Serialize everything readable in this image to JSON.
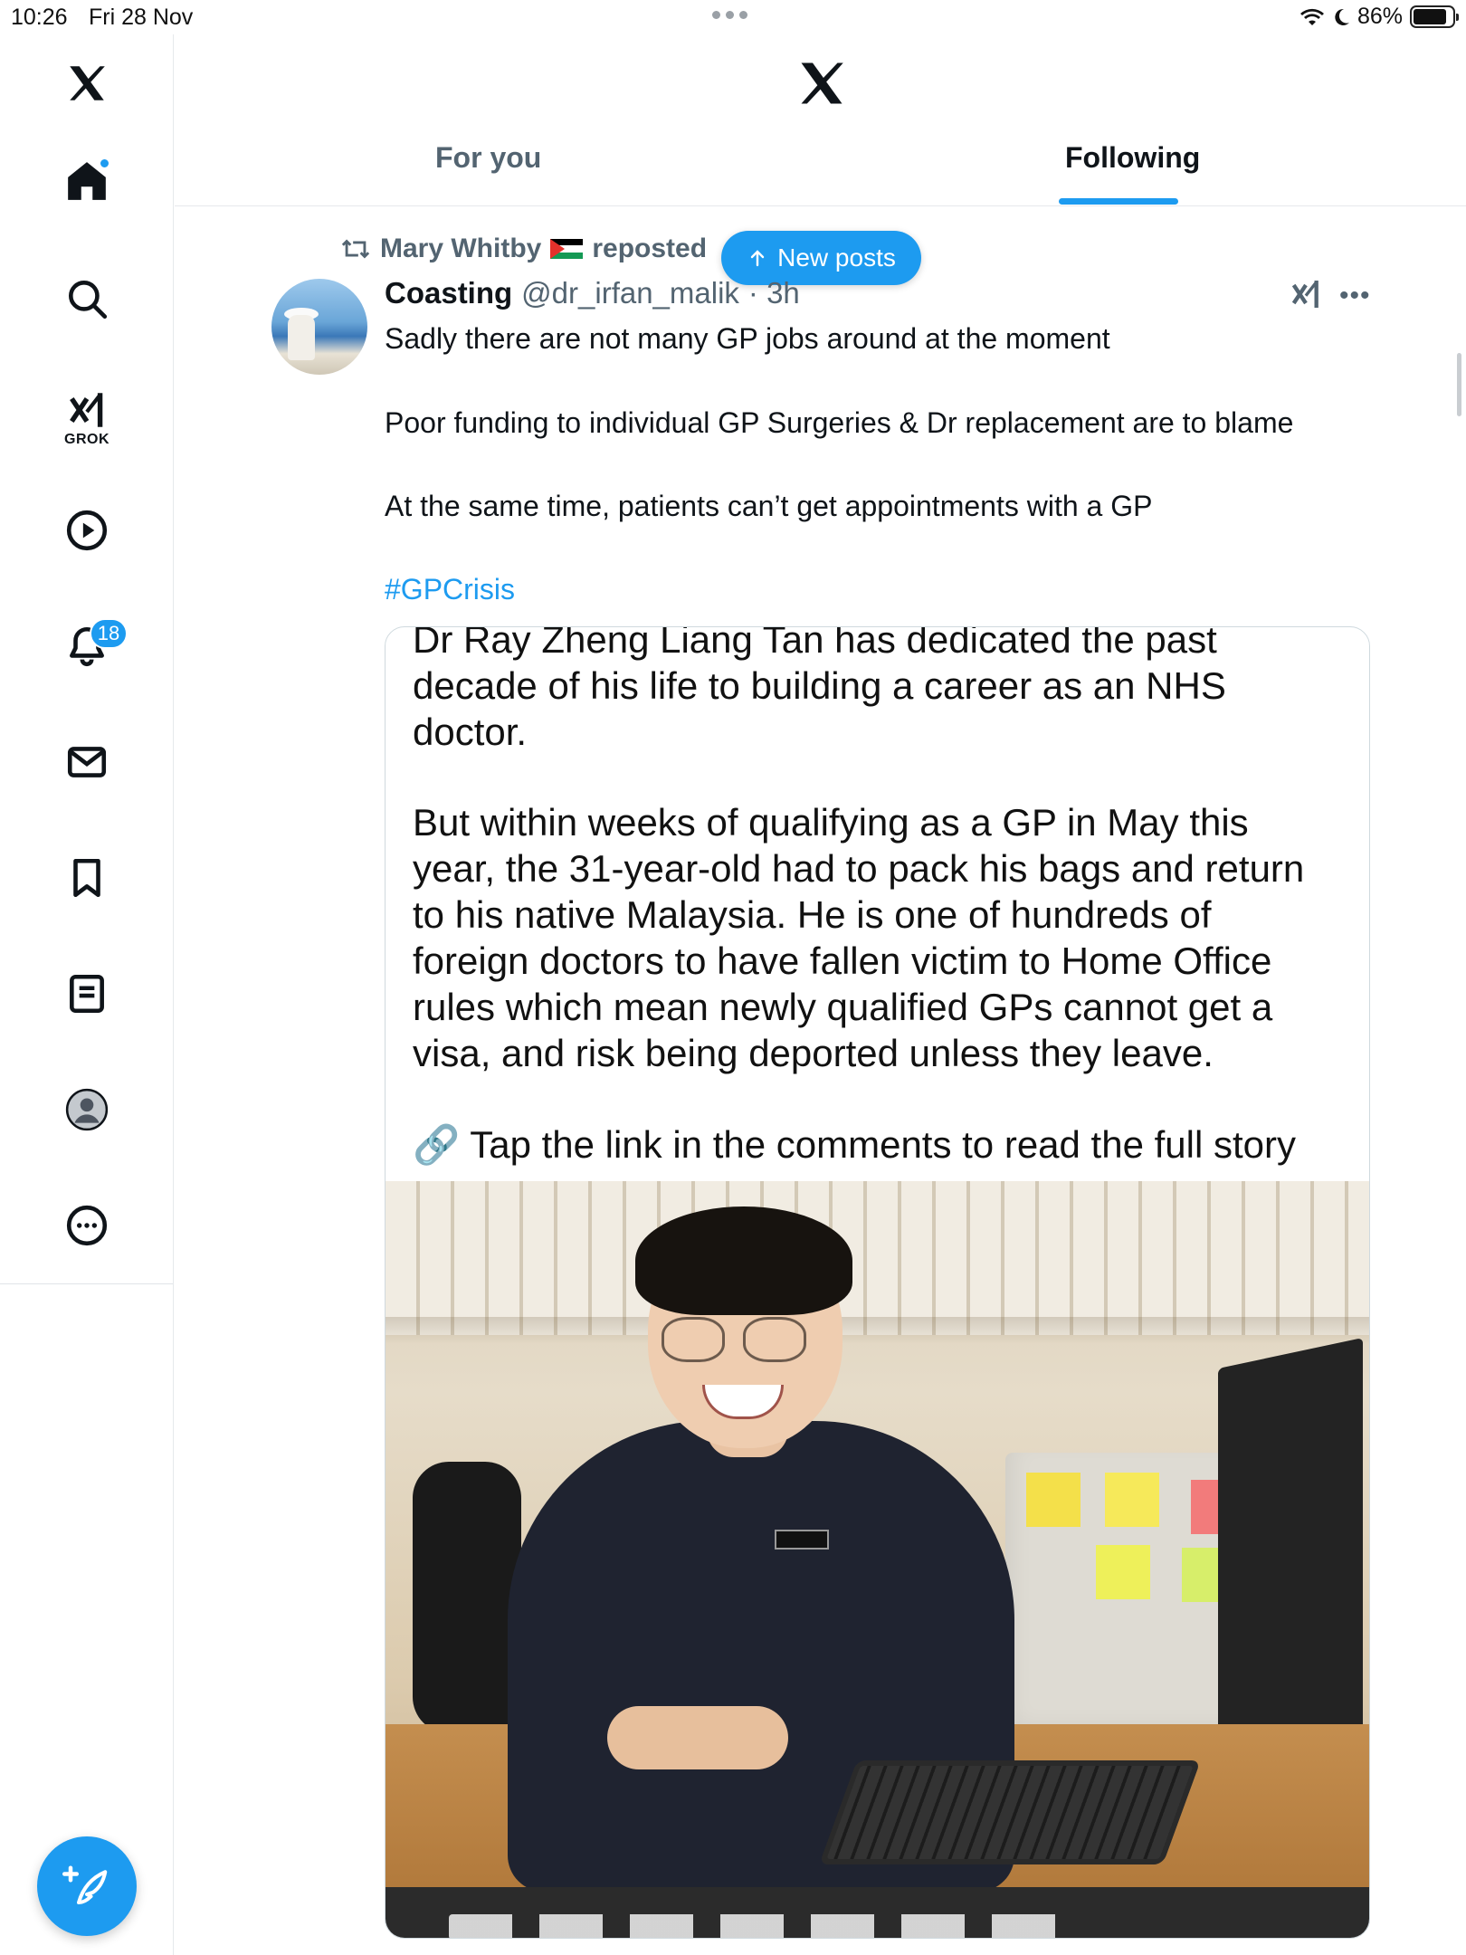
{
  "status_bar": {
    "time": "10:26",
    "date": "Fri 28 Nov",
    "battery": "86%",
    "battery_level": 0.86
  },
  "sidebar": {
    "items": [
      {
        "name": "x-logo",
        "icon": "x-logo-icon"
      },
      {
        "name": "home",
        "icon": "home-icon",
        "active": true
      },
      {
        "name": "search",
        "icon": "search-icon"
      },
      {
        "name": "grok",
        "icon": "grok-icon",
        "label": "GROK"
      },
      {
        "name": "video",
        "icon": "play-circle-icon"
      },
      {
        "name": "notifications",
        "icon": "bell-icon",
        "badge": "18"
      },
      {
        "name": "messages",
        "icon": "envelope-icon"
      },
      {
        "name": "bookmarks",
        "icon": "bookmark-icon"
      },
      {
        "name": "lists",
        "icon": "list-icon"
      },
      {
        "name": "profile",
        "icon": "avatar-icon"
      },
      {
        "name": "more",
        "icon": "more-circle-icon"
      }
    ],
    "compose_icon": "compose-icon"
  },
  "header": {
    "logo": "x-logo-icon",
    "tabs": [
      {
        "label": "For you",
        "active": false
      },
      {
        "label": "Following",
        "active": true
      }
    ]
  },
  "new_posts_pill": {
    "label": "New posts",
    "icon": "arrow-up-icon"
  },
  "post": {
    "repost": {
      "by": "Mary Whitby",
      "flag": "palestine-flag-emoji",
      "suffix": "reposted"
    },
    "author": {
      "name": "Coasting",
      "handle": "@dr_irfan_malik",
      "time": "· 3h"
    },
    "paragraphs": [
      "Sadly there are not many GP jobs around at the moment",
      "Poor funding to individual GP Surgeries & Dr replacement are to blame",
      "At the same time, patients can’t get appointments with a GP"
    ],
    "hashtag": "#GPCrisis",
    "media": {
      "lines": [
        "Dr Ray Zheng Liang Tan has dedicated the past",
        "decade of his life to building a career as an NHS",
        "doctor.",
        "But within weeks of qualifying as a GP in May this",
        "year, the 31-year-old had to pack his bags and return",
        "to his native Malaysia. He is one of hundreds of",
        "foreign doctors to have fallen victim to Home Office",
        "rules which mean newly qualified GPs cannot get a",
        "visa, and risk being deported unless they leave.",
        "🔗 Tap the link in the comments to read the full story"
      ]
    }
  },
  "colors": {
    "accent": "#1d9bf0",
    "text_primary": "#0f1419",
    "text_secondary": "#536471",
    "border": "#cfd9de"
  }
}
